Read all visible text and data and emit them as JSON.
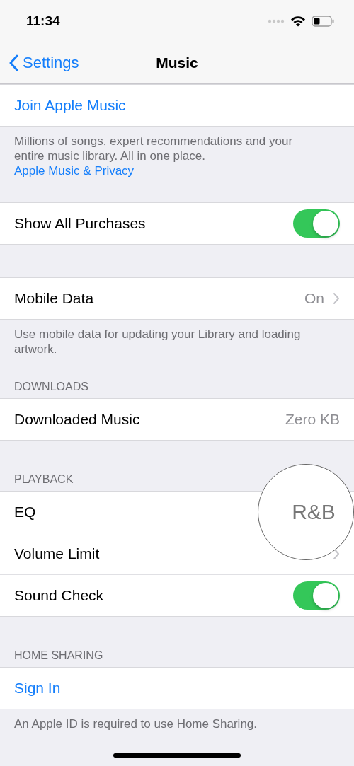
{
  "status_bar": {
    "time": "11:34"
  },
  "nav": {
    "back": "Settings",
    "title": "Music"
  },
  "sections": [
    {
      "rows": [
        {
          "kind": "link",
          "label": "Join Apple Music"
        }
      ],
      "footer": {
        "text": "Millions of songs, expert recommendations and your entire music library. All in one place.",
        "link": "Apple Music & Privacy"
      }
    },
    {
      "rows": [
        {
          "kind": "toggle",
          "label": "Show All Purchases",
          "on": true
        }
      ]
    },
    {
      "rows": [
        {
          "kind": "value",
          "label": "Mobile Data",
          "value": "On"
        }
      ],
      "footer": {
        "text": "Use mobile data for updating your Library and loading artwork."
      }
    },
    {
      "header": "DOWNLOADS",
      "rows": [
        {
          "kind": "info",
          "label": "Downloaded Music",
          "value": "Zero KB"
        }
      ]
    },
    {
      "header": "PLAYBACK",
      "rows": [
        {
          "kind": "magnified",
          "label": "EQ",
          "value": "R&B"
        },
        {
          "kind": "value",
          "label": "Volume Limit"
        },
        {
          "kind": "toggle",
          "label": "Sound Check",
          "on": true
        }
      ]
    },
    {
      "header": "HOME SHARING",
      "rows": [
        {
          "kind": "link",
          "label": "Sign In"
        }
      ],
      "footer": {
        "text": "An Apple ID is required to use Home Sharing."
      }
    }
  ]
}
